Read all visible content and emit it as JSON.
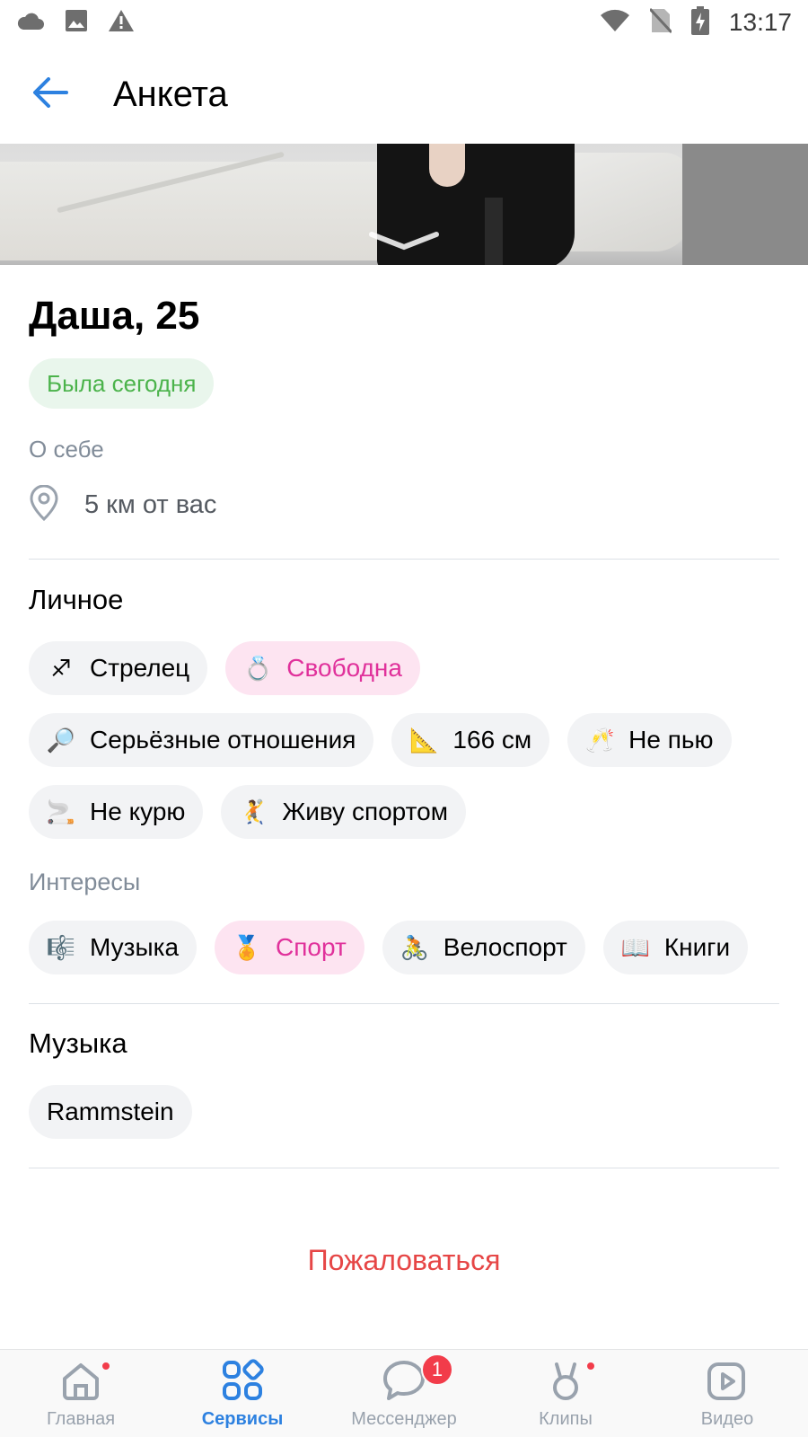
{
  "status_bar": {
    "time": "13:17",
    "left_icons": [
      "cloud-icon",
      "image-icon",
      "warning-icon"
    ],
    "right_icons": [
      "wifi-icon",
      "no-sim-icon",
      "battery-charging-icon"
    ]
  },
  "header": {
    "title": "Анкета",
    "back_icon": "arrow-left-icon"
  },
  "profile": {
    "name": "Даша, 25",
    "online_status": "Была сегодня",
    "about_label": "О себе",
    "location": "5 км от вас"
  },
  "personal": {
    "title": "Личное",
    "chips": [
      {
        "icon": "♐",
        "label": "Стрелец",
        "highlight": false
      },
      {
        "icon": "💍",
        "label": "Свободна",
        "highlight": true
      },
      {
        "icon": "🔎",
        "label": "Серьёзные отношения",
        "highlight": false
      },
      {
        "icon": "📐",
        "label": "166 см",
        "highlight": false
      },
      {
        "icon": "🥂",
        "label": "Не пью",
        "highlight": false
      },
      {
        "icon": "🚬",
        "label": "Не курю",
        "highlight": false
      },
      {
        "icon": "🤾",
        "label": "Живу спортом",
        "highlight": false
      }
    ]
  },
  "interests": {
    "title": "Интересы",
    "chips": [
      {
        "icon": "🎼",
        "label": "Музыка",
        "highlight": false
      },
      {
        "icon": "🏅",
        "label": "Спорт",
        "highlight": true
      },
      {
        "icon": "🚴",
        "label": "Велоспорт",
        "highlight": false
      },
      {
        "icon": "📖",
        "label": "Книги",
        "highlight": false
      }
    ]
  },
  "music": {
    "title": "Музыка",
    "chips": [
      {
        "label": "Rammstein"
      }
    ]
  },
  "report_label": "Пожаловаться",
  "tabbar": {
    "tabs": [
      {
        "label": "Главная",
        "icon": "home-icon",
        "active": false,
        "dot": true
      },
      {
        "label": "Сервисы",
        "icon": "services-icon",
        "active": true
      },
      {
        "label": "Мессенджер",
        "icon": "messenger-icon",
        "active": false,
        "badge": "1"
      },
      {
        "label": "Клипы",
        "icon": "clips-icon",
        "active": false,
        "dot": true
      },
      {
        "label": "Видео",
        "icon": "video-icon",
        "active": false
      }
    ]
  },
  "colors": {
    "accent": "#2d81e0",
    "online": "#4bb34b",
    "pink": "#e0319b",
    "danger": "#e64646"
  }
}
